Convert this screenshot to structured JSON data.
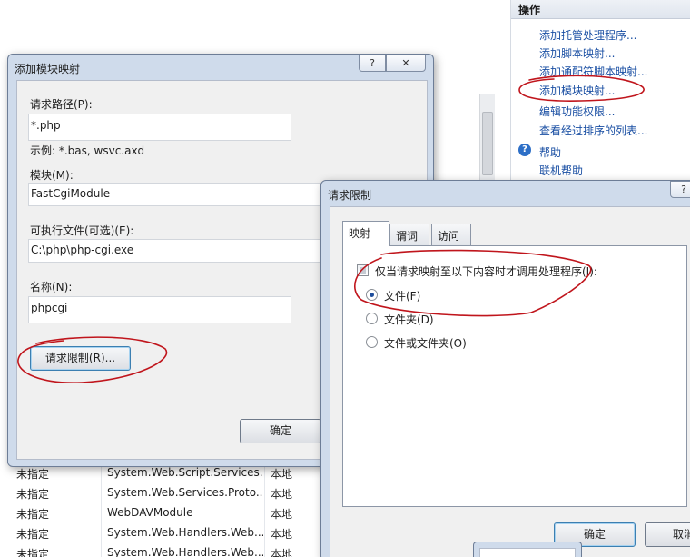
{
  "actions": {
    "header": "操作",
    "links": [
      "添加托管处理程序...",
      "添加脚本映射...",
      "添加通配符脚本映射...",
      "添加模块映射...",
      "编辑功能权限...",
      "查看经过排序的列表..."
    ],
    "help": "帮助",
    "online_help": "联机帮助"
  },
  "bg_table": {
    "rows": [
      [
        "未指定",
        "System.Web.Script.Services...",
        "本地"
      ],
      [
        "未指定",
        "System.Web.Services.Proto...",
        "本地"
      ],
      [
        "未指定",
        "WebDAVModule",
        "本地"
      ],
      [
        "未指定",
        "System.Web.Handlers.Web...",
        "本地"
      ],
      [
        "未指定",
        "System.Web.Handlers.Web...",
        "本地"
      ]
    ]
  },
  "add_module_dialog": {
    "title": "添加模块映射",
    "help_btn": "?",
    "close_btn": "✕",
    "request_path_label": "请求路径(P):",
    "request_path_value": "*.php",
    "example": "示例: *.bas, wsvc.axd",
    "module_label": "模块(M):",
    "module_value": "FastCgiModule",
    "executable_label": "可执行文件(可选)(E):",
    "executable_value": "C:\\php\\php-cgi.exe",
    "name_label": "名称(N):",
    "name_value": "phpcgi",
    "request_restrictions_btn": "请求限制(R)...",
    "ok_btn": "确定"
  },
  "restrictions_dialog": {
    "title": "请求限制",
    "help_btn": "?",
    "tabs": [
      "映射",
      "谓词",
      "访问"
    ],
    "checkbox_label": "仅当请求映射至以下内容时才调用处理程序(I):",
    "radio_file": "文件(F)",
    "radio_folder": "文件夹(D)",
    "radio_file_or_folder": "文件或文件夹(O)",
    "ok_btn": "确定",
    "cancel_btn": "取消"
  },
  "colors": {
    "annotation": "#c0151c",
    "link": "#1a4fa3",
    "dialog_frame": "#cfdbeb"
  }
}
